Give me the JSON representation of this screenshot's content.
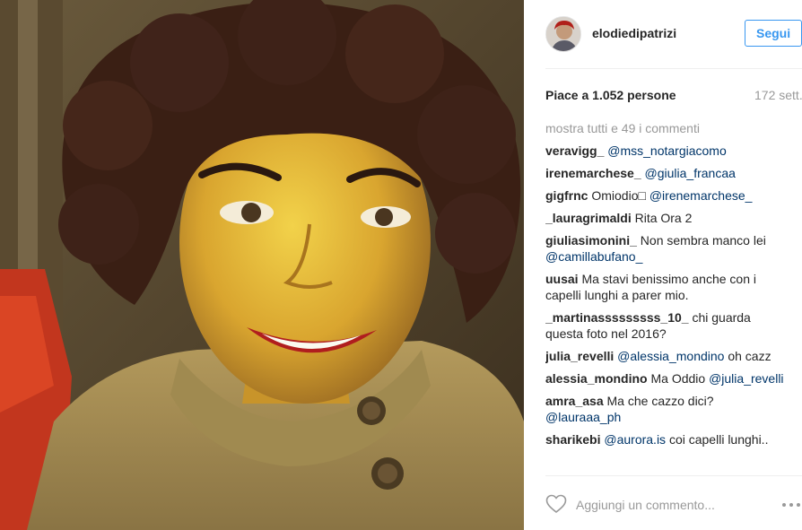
{
  "post": {
    "username": "elodiedipatrizi",
    "follow_label": "Segui",
    "likes": "Piace a 1.052 persone",
    "time": "172 sett.",
    "show_all": "mostra tutti e 49 i commenti",
    "comment_placeholder": "Aggiungi un commento...",
    "more_icon": "more-options-icon",
    "heart_icon": "heart-outline-icon"
  },
  "comments": [
    {
      "user": "veravigg_",
      "parts": [
        {
          "t": "mention",
          "v": "@mss_notargiacomo"
        }
      ]
    },
    {
      "user": "irenemarchese_",
      "parts": [
        {
          "t": "mention",
          "v": "@giulia_francaa"
        }
      ]
    },
    {
      "user": "gigfrnc",
      "parts": [
        {
          "t": "text",
          "v": "Omiodio□ "
        },
        {
          "t": "mention",
          "v": "@irenemarchese_"
        }
      ]
    },
    {
      "user": "_lauragrimaldi",
      "parts": [
        {
          "t": "text",
          "v": "Rita Ora 2"
        }
      ]
    },
    {
      "user": "giuliasimonini_",
      "parts": [
        {
          "t": "text",
          "v": "Non sembra manco lei "
        },
        {
          "t": "mention",
          "v": "@camillabufano_"
        }
      ]
    },
    {
      "user": "uusai",
      "parts": [
        {
          "t": "text",
          "v": "Ma stavi benissimo anche con i capelli lunghi a parer mio."
        }
      ]
    },
    {
      "user": "_martinasssssssss_10_",
      "parts": [
        {
          "t": "text",
          "v": "chi guarda questa foto nel 2016?"
        }
      ]
    },
    {
      "user": "julia_revelli",
      "parts": [
        {
          "t": "mention",
          "v": "@alessia_mondino"
        },
        {
          "t": "text",
          "v": " oh cazz"
        }
      ]
    },
    {
      "user": "alessia_mondino",
      "parts": [
        {
          "t": "text",
          "v": "Ma Oddio "
        },
        {
          "t": "mention",
          "v": "@julia_revelli"
        }
      ]
    },
    {
      "user": "amra_asa",
      "parts": [
        {
          "t": "text",
          "v": "Ma che cazzo dici? "
        },
        {
          "t": "mention",
          "v": "@lauraaa_ph"
        }
      ]
    },
    {
      "user": "sharikebi",
      "parts": [
        {
          "t": "mention",
          "v": "@aurora.is"
        },
        {
          "t": "text",
          "v": " coi capelli lunghi.."
        }
      ]
    }
  ],
  "colors": {
    "accent": "#3897f0",
    "mention": "#003569",
    "muted": "#999999",
    "text": "#262626",
    "border": "#efefef"
  }
}
